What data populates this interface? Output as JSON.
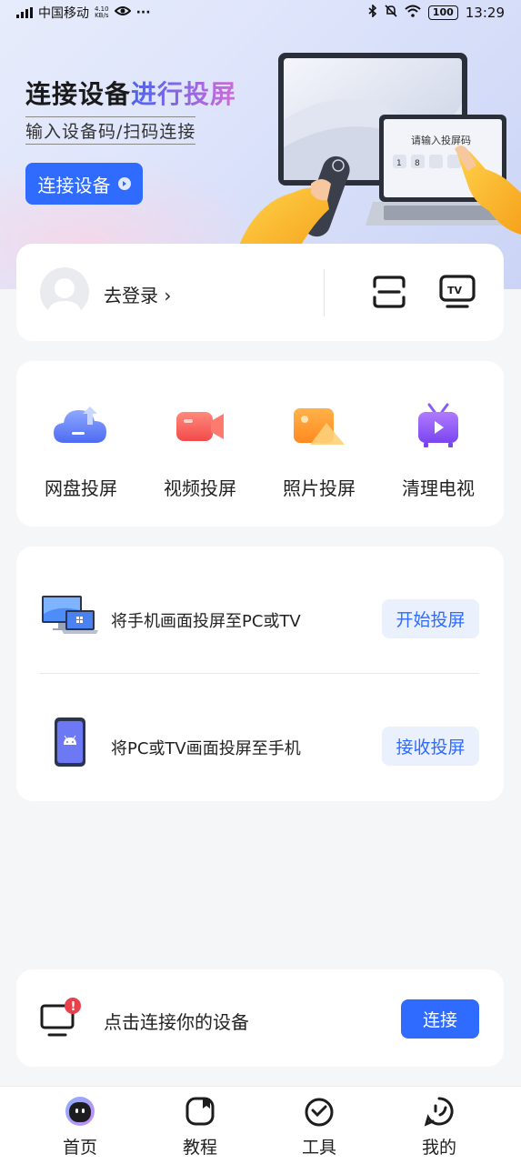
{
  "status_bar": {
    "carrier": "中国移动",
    "net_speed_value": "4.10",
    "net_speed_unit": "KB/s",
    "more": "···",
    "battery": "100",
    "time": "13:29"
  },
  "hero": {
    "title_part1": "连接设备",
    "title_part2": "进行投屏",
    "subtitle": "输入设备码/扫码连接",
    "connect_button": "连接设备",
    "art_prompt": "请输入投屏码",
    "art_code_digits": [
      "1",
      "8"
    ]
  },
  "login": {
    "text": "去登录 ›"
  },
  "features": [
    {
      "label": "网盘投屏",
      "icon": "cloud-upload-icon"
    },
    {
      "label": "视频投屏",
      "icon": "video-camera-icon"
    },
    {
      "label": "照片投屏",
      "icon": "photo-icon"
    },
    {
      "label": "清理电视",
      "icon": "tv-clean-icon"
    }
  ],
  "cast_options": [
    {
      "text": "将手机画面投屏至PC或TV",
      "button": "开始投屏",
      "icon": "pc-laptop-icon"
    },
    {
      "text": "将PC或TV画面投屏至手机",
      "button": "接收投屏",
      "icon": "phone-android-icon"
    }
  ],
  "device_prompt": {
    "text": "点击连接你的设备",
    "button": "连接",
    "badge": "!"
  },
  "tabbar": [
    {
      "label": "首页",
      "icon": "home-robot-icon",
      "active": true
    },
    {
      "label": "教程",
      "icon": "tutorial-book-icon",
      "active": false
    },
    {
      "label": "工具",
      "icon": "tools-clock-icon",
      "active": false
    },
    {
      "label": "我的",
      "icon": "profile-face-icon",
      "active": false
    }
  ],
  "colors": {
    "accent": "#2f6bff",
    "accent_light": "#ebf0fd",
    "badge_red": "#e8414b"
  }
}
